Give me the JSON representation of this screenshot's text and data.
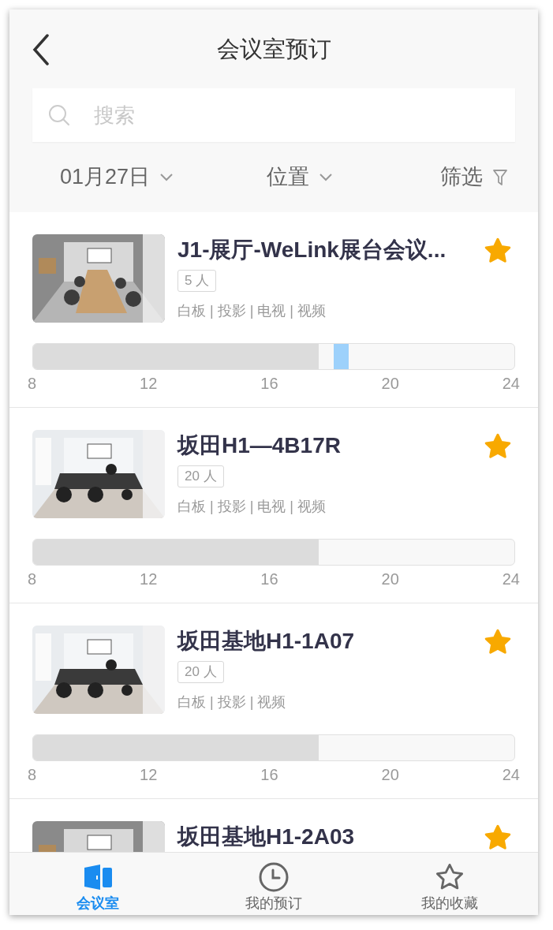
{
  "header": {
    "title": "会议室预订"
  },
  "search": {
    "placeholder": "搜索"
  },
  "filters": [
    {
      "kind": "dropdown",
      "label": "01月27日"
    },
    {
      "kind": "dropdown",
      "label": "位置"
    },
    {
      "kind": "filter",
      "label": "筛选"
    }
  ],
  "rooms": [
    {
      "name": "J1-展厅-WeLink展台会议...",
      "capacity": "5 人",
      "amenities": "白板 | 投影 | 电视 | 视频",
      "favorite": true,
      "timeline": {
        "level": 0.594,
        "bookings": [
          {
            "level": 0.625
          }
        ],
        "ticks": [
          "8",
          "12",
          "16",
          "20",
          "24"
        ]
      }
    },
    {
      "name": "坂田H1—4B17R",
      "capacity": "20 人",
      "amenities": "白板 | 投影 | 电视 | 视频",
      "favorite": true,
      "timeline": {
        "level": 0.594,
        "ticks": [
          "8",
          "12",
          "16",
          "20",
          "24"
        ]
      }
    },
    {
      "name": "坂田基地H1-1A07",
      "capacity": "20 人",
      "amenities": "白板 | 投影 | 视频",
      "favorite": true,
      "timeline": {
        "level": 0.594,
        "ticks": [
          "8",
          "12",
          "16",
          "20",
          "24"
        ]
      }
    },
    {
      "name": "坂田基地H1-2A03",
      "favorite": true
    }
  ],
  "tabs": [
    {
      "label": "会议室",
      "selected": true
    },
    {
      "label": "我的预订",
      "selected": false
    },
    {
      "label": "我的收藏",
      "selected": false
    }
  ]
}
